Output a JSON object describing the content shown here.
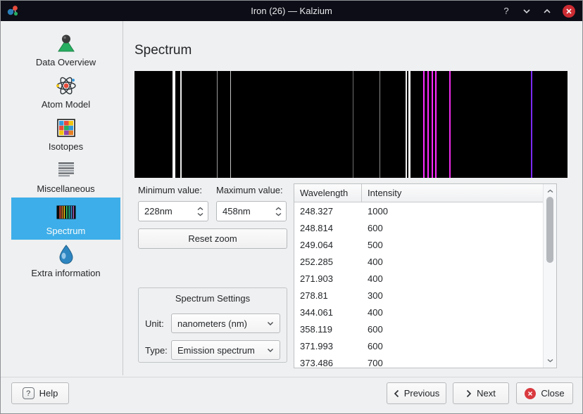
{
  "window": {
    "title": "Iron (26) — Kalzium",
    "controls": {
      "help_glyph": "?"
    }
  },
  "sidebar": {
    "selected": "Spectrum",
    "highlight_color": "#3daee9",
    "items": [
      {
        "label": "Data Overview",
        "icon": "flask-icon"
      },
      {
        "label": "Atom Model",
        "icon": "atom-icon"
      },
      {
        "label": "Isotopes",
        "icon": "isotopes-grid-icon"
      },
      {
        "label": "Miscellaneous",
        "icon": "list-lines-icon"
      },
      {
        "label": "Spectrum",
        "icon": "spectrum-bars-icon"
      },
      {
        "label": "Extra information",
        "icon": "blue-drop-icon"
      }
    ]
  },
  "main": {
    "title": "Spectrum",
    "minimum_label": "Minimum value:",
    "maximum_label": "Maximum value:",
    "minimum_value": "228nm",
    "maximum_value": "458nm",
    "reset_zoom_label": "Reset zoom",
    "settings": {
      "title": "Spectrum Settings",
      "unit_label": "Unit:",
      "unit_value": "nanometers (nm)",
      "type_label": "Type:",
      "type_value": "Emission spectrum"
    }
  },
  "table": {
    "columns": [
      "Wavelength",
      "Intensity"
    ],
    "rows": [
      [
        "248.327",
        "1000"
      ],
      [
        "248.814",
        "600"
      ],
      [
        "249.064",
        "500"
      ],
      [
        "252.285",
        "400"
      ],
      [
        "271.903",
        "400"
      ],
      [
        "278.81",
        "300"
      ],
      [
        "344.061",
        "400"
      ],
      [
        "358.119",
        "600"
      ],
      [
        "371.993",
        "600"
      ],
      [
        "373.486",
        "700"
      ]
    ]
  },
  "chart_data": {
    "type": "spectrum",
    "title": "Iron emission spectrum",
    "spectrum_type": "Emission spectrum",
    "unit": "nanometers (nm)",
    "x_range_nm": [
      228,
      458
    ],
    "background": "#000000",
    "lines": [
      {
        "wavelength": 248.327,
        "intensity": 1000,
        "color": "#ffffff",
        "width": 2
      },
      {
        "wavelength": 248.814,
        "intensity": 600,
        "color": "#ffffff",
        "width": 2
      },
      {
        "wavelength": 249.064,
        "intensity": 500,
        "color": "#ffffff",
        "width": 2
      },
      {
        "wavelength": 252.285,
        "intensity": 400,
        "color": "#ececec",
        "width": 2
      },
      {
        "wavelength": 271.903,
        "intensity": 400,
        "color": "#9a9a9a",
        "width": 1
      },
      {
        "wavelength": 278.81,
        "intensity": 300,
        "color": "#c4c4c4",
        "width": 1
      },
      {
        "wavelength": 344.061,
        "intensity": 400,
        "color": "#6f6f6f",
        "width": 1
      },
      {
        "wavelength": 358.119,
        "intensity": 600,
        "color": "#8d8d8d",
        "width": 1
      },
      {
        "wavelength": 371.993,
        "intensity": 600,
        "color": "#f2f2f2",
        "width": 2
      },
      {
        "wavelength": 373.486,
        "intensity": 700,
        "color": "#ffffff",
        "width": 3
      },
      {
        "wavelength": 381.3,
        "color": "#ff2bff",
        "width": 2
      },
      {
        "wavelength": 383.6,
        "color": "#ff2bff",
        "width": 2
      },
      {
        "wavelength": 385.8,
        "color": "#ff2bff",
        "width": 2
      },
      {
        "wavelength": 387.7,
        "color": "#ff2bff",
        "width": 2
      },
      {
        "wavelength": 395.2,
        "color": "#f02bf0",
        "width": 2
      },
      {
        "wavelength": 438.5,
        "color": "#7a2bff",
        "width": 2
      }
    ]
  },
  "footer": {
    "help_label": "Help",
    "previous_label": "Previous",
    "next_label": "Next",
    "close_label": "Close"
  }
}
